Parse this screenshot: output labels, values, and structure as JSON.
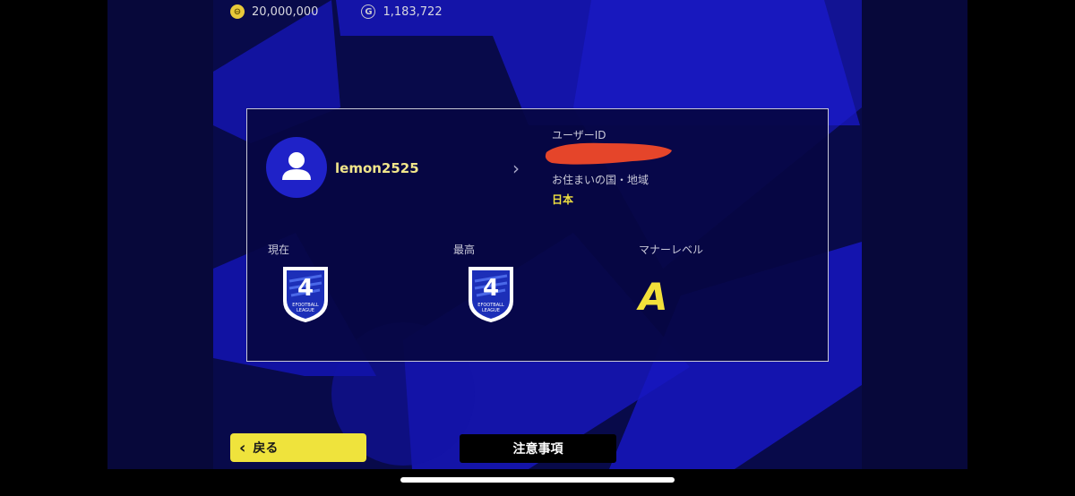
{
  "currency": {
    "coins": "20,000,000",
    "gp_symbol": "G",
    "gp": "1,183,722"
  },
  "profile": {
    "username": "lemon2525",
    "user_id_label": "ユーザーID",
    "country_label": "お住まいの国・地域",
    "country_value": "日本",
    "current_label": "現在",
    "highest_label": "最高",
    "manner_label": "マナーレベル",
    "manner_grade": "A",
    "chevron": "›"
  },
  "footer": {
    "back_label": "戻る",
    "back_arrow": "‹",
    "notice_label": "注意事項"
  },
  "colors": {
    "background": "#080a4a",
    "accent_blue": "#1f22c8",
    "accent_yellow": "#efe33c",
    "redaction": "#e5452a"
  },
  "icons": {
    "coin": "coin-icon",
    "gp": "gp-icon",
    "avatar": "user-avatar-icon",
    "badge": "efootball-league-division-4-badge"
  }
}
